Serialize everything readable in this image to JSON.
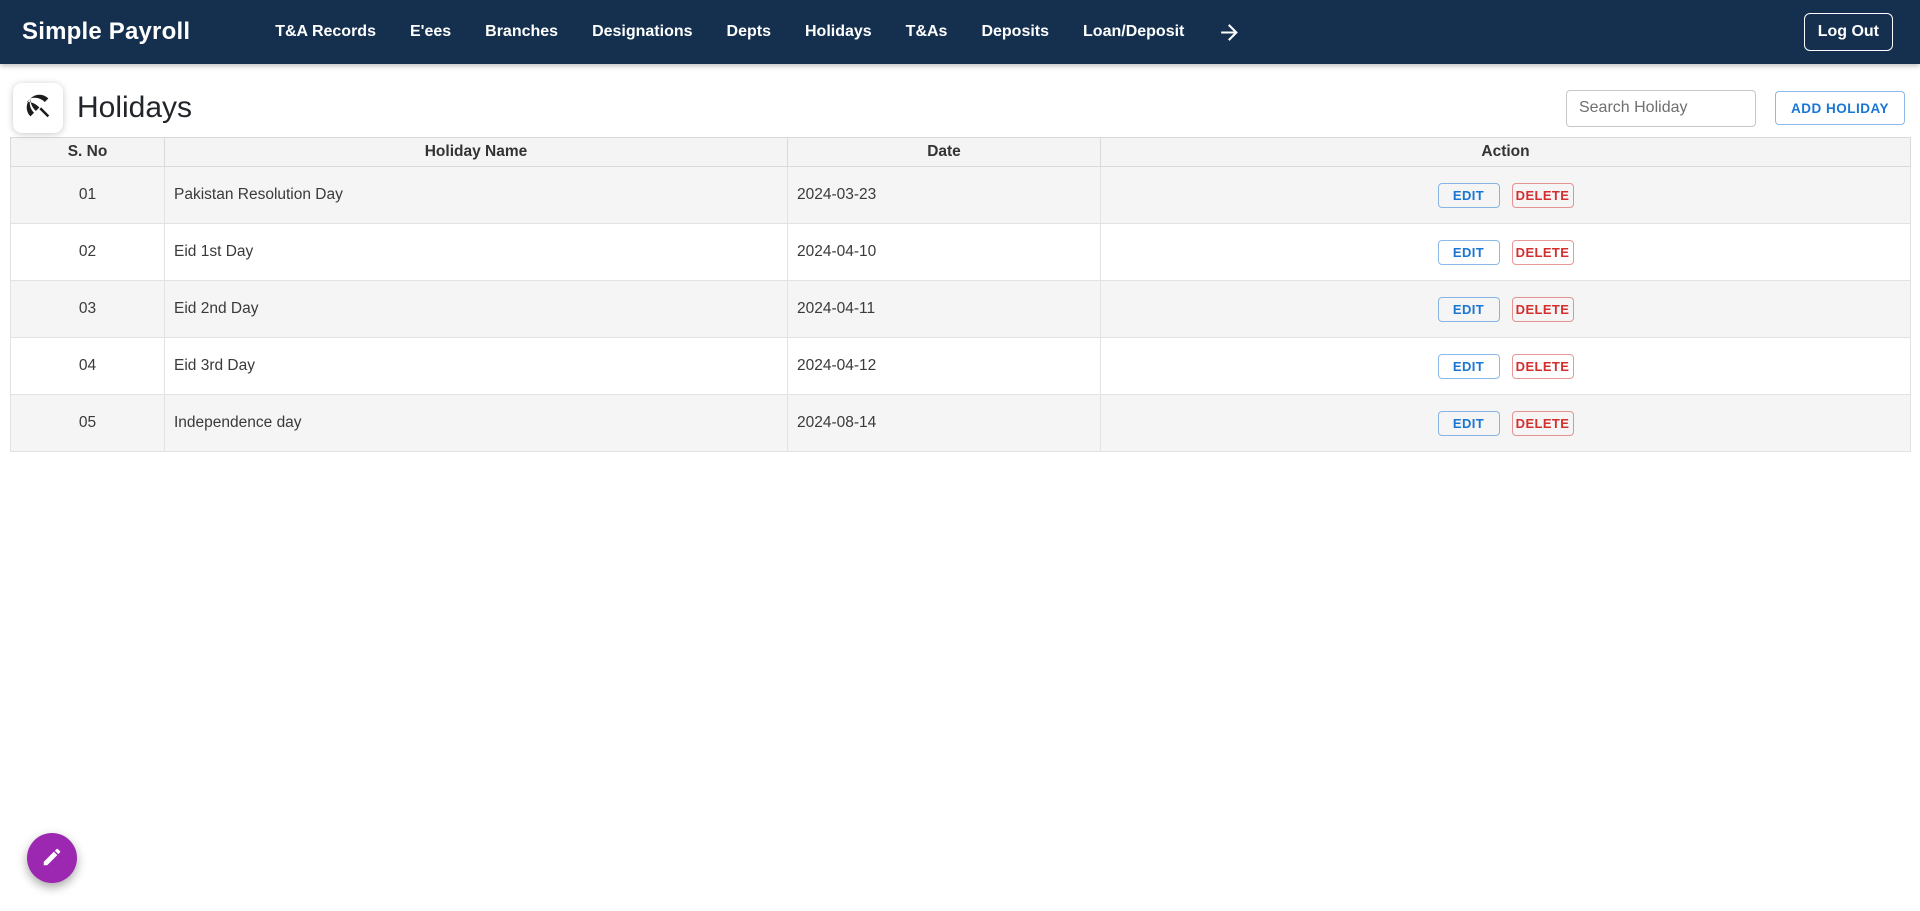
{
  "navbar": {
    "brand": "Simple Payroll",
    "items": [
      {
        "label": "T&A Records"
      },
      {
        "label": "E'ees"
      },
      {
        "label": "Branches"
      },
      {
        "label": "Designations"
      },
      {
        "label": "Depts"
      },
      {
        "label": "Holidays"
      },
      {
        "label": "T&As"
      },
      {
        "label": "Deposits"
      },
      {
        "label": "Loan/Deposit"
      }
    ],
    "more_icon": "arrow-forward-icon",
    "logout_label": "Log Out"
  },
  "header": {
    "icon": "beach-umbrella-icon",
    "title": "Holidays",
    "search": {
      "placeholder": "Search Holiday",
      "value": ""
    },
    "add_button_label": "ADD HOLIDAY"
  },
  "table": {
    "columns": [
      "S. No",
      "Holiday Name",
      "Date",
      "Action"
    ],
    "rows": [
      {
        "s_no": "01",
        "name": "Pakistan Resolution Day",
        "date": "2024-03-23"
      },
      {
        "s_no": "02",
        "name": "Eid 1st Day",
        "date": "2024-04-10"
      },
      {
        "s_no": "03",
        "name": "Eid 2nd Day",
        "date": "2024-04-11"
      },
      {
        "s_no": "04",
        "name": "Eid 3rd Day",
        "date": "2024-04-12"
      },
      {
        "s_no": "05",
        "name": "Independence day",
        "date": "2024-08-14"
      }
    ],
    "edit_label": "EDIT",
    "delete_label": "DELETE"
  },
  "fab": {
    "icon": "pencil-icon"
  },
  "colors": {
    "navbar_bg": "#14304e",
    "primary_blue": "#1976d2",
    "danger_red": "#d32f2f",
    "fab_purple": "#9c27b0",
    "row_stripe": "#f5f5f5"
  }
}
